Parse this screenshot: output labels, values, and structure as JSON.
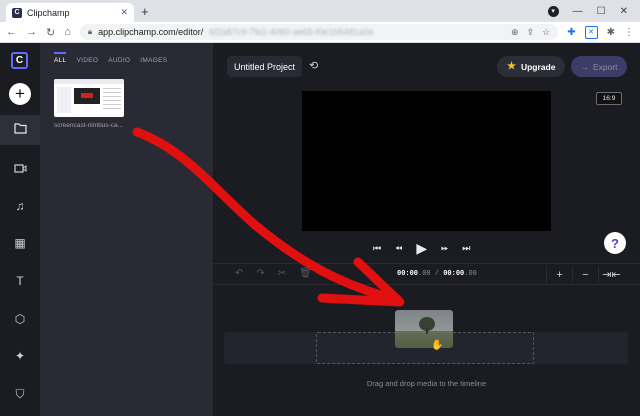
{
  "browser": {
    "tab_title": "Clipchamp",
    "tab_favicon": "C",
    "url_host": "app.clipchamp.com/editor/",
    "url_rest": "6f2a87c9-7fe2-4060-ae65-f0e1b5481a0e"
  },
  "sidebar": {
    "logo": "C",
    "add_label": "+",
    "items": [
      {
        "icon": "folder-icon",
        "glyph": "▭"
      },
      {
        "icon": "video-icon",
        "glyph": "▭"
      },
      {
        "icon": "music-icon",
        "glyph": "♫"
      },
      {
        "icon": "film-icon",
        "glyph": "▦"
      },
      {
        "icon": "text-icon",
        "glyph": "T"
      },
      {
        "icon": "cube-icon",
        "glyph": "⬡"
      },
      {
        "icon": "sparkle-icon",
        "glyph": "✦"
      },
      {
        "icon": "shield-icon",
        "glyph": "⛉"
      }
    ]
  },
  "media": {
    "tabs": [
      "ALL",
      "VIDEO",
      "AUDIO",
      "IMAGES"
    ],
    "file_name": "screencast-nimbus-ca..."
  },
  "editor": {
    "project_name": "Untitled Project",
    "upgrade_label": "Upgrade",
    "export_label": "Export",
    "aspect_ratio": "16:9",
    "help_label": "?",
    "timecode_current": "00:00",
    "timecode_current_frac": ".00",
    "timecode_sep": " / ",
    "timecode_total": "00:00",
    "timecode_total_frac": ".00",
    "drop_hint": "Drag and drop media to the timeline"
  },
  "colors": {
    "accent": "#5f6cff",
    "annotation": "#e01010"
  }
}
